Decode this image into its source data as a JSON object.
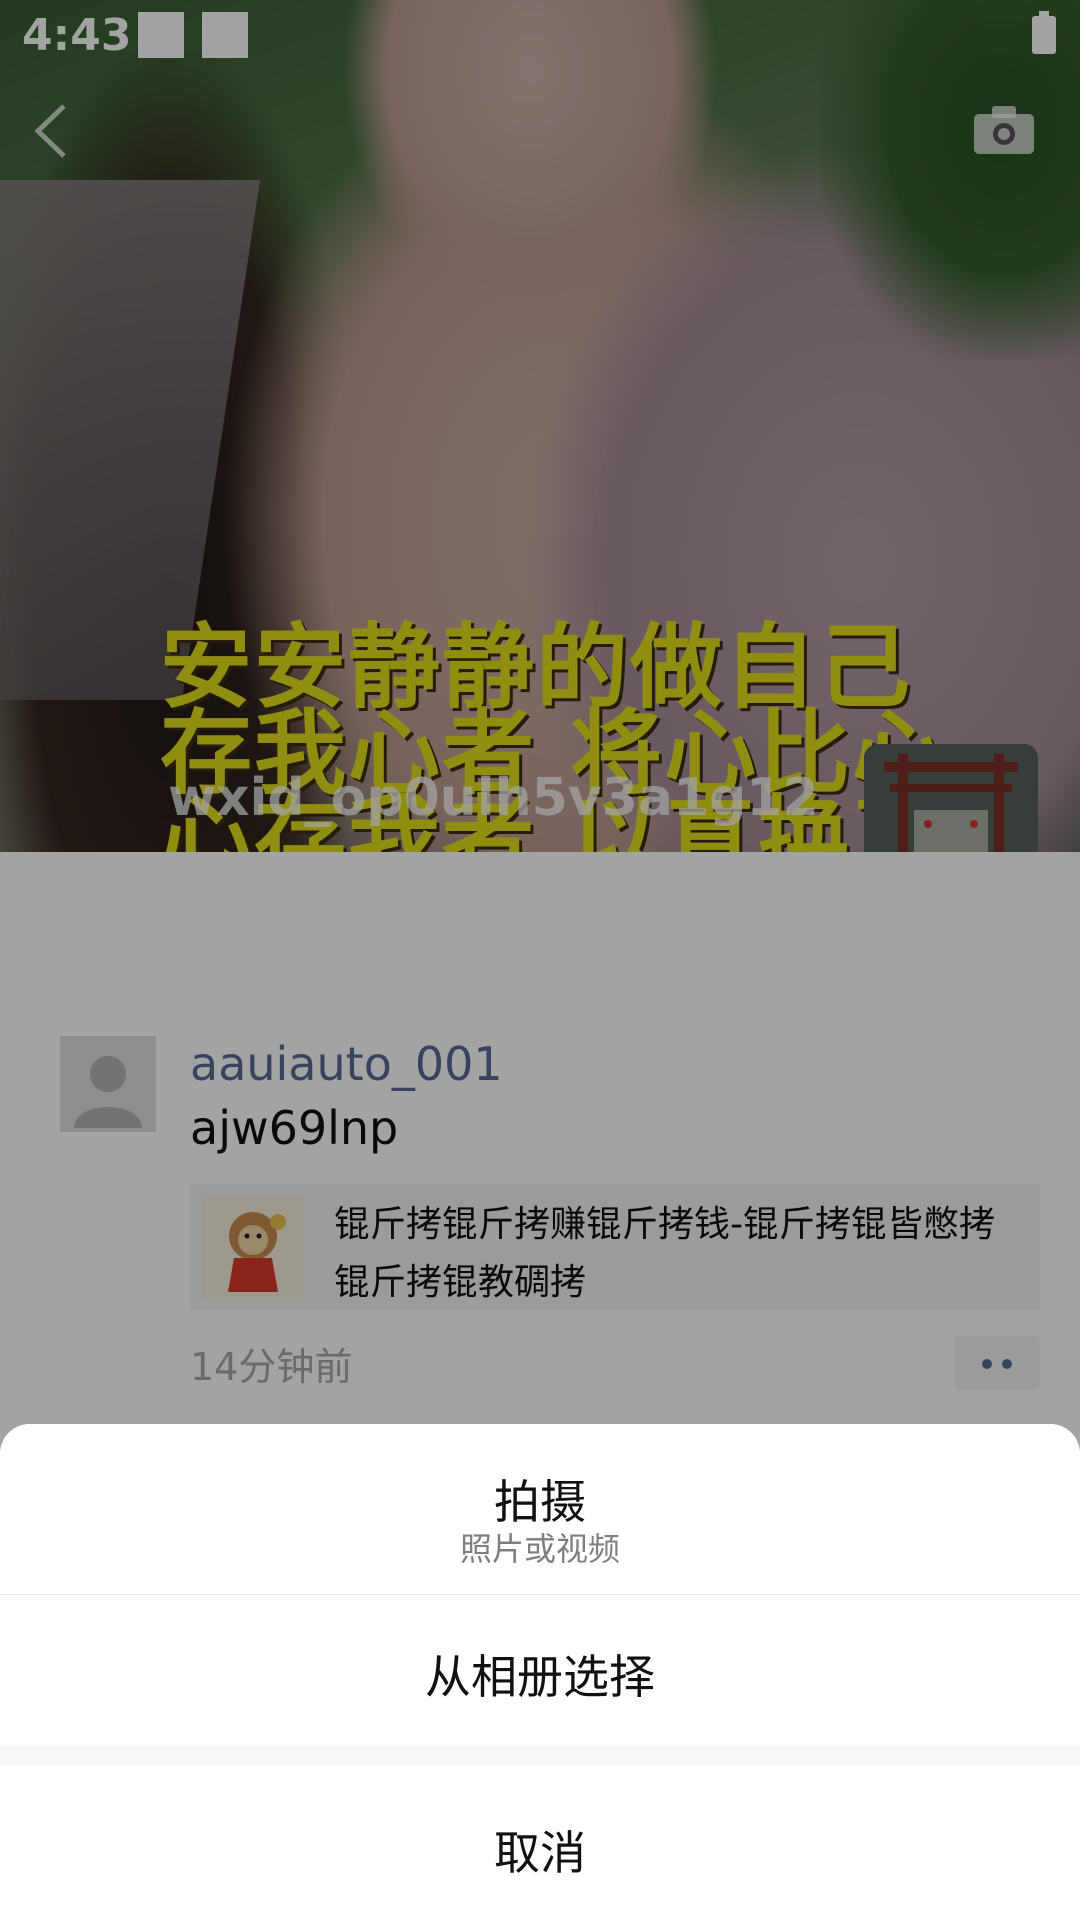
{
  "status_bar": {
    "time": "4:43"
  },
  "cover": {
    "caption_lines": [
      "安安静静的做自己",
      "存我心者 将心比心",
      "心存我者 以真换真"
    ],
    "user_name": "wxid_op0ulh5v3a1g12"
  },
  "post": {
    "author": "aauiauto_001",
    "text": "ajw69lnp",
    "link_title": "锟斤拷锟斤拷赚锟斤拷钱-锟斤拷锟皆憋拷锟斤拷锟教碉拷",
    "time": "14分钟前"
  },
  "action_sheet": {
    "shoot_label": "拍摄",
    "shoot_sub": "照片或视频",
    "album_label": "从相册选择",
    "cancel_label": "取消"
  },
  "icons": {
    "back": "chevron-left-icon",
    "camera": "camera-icon",
    "more": "more-dots-icon"
  }
}
